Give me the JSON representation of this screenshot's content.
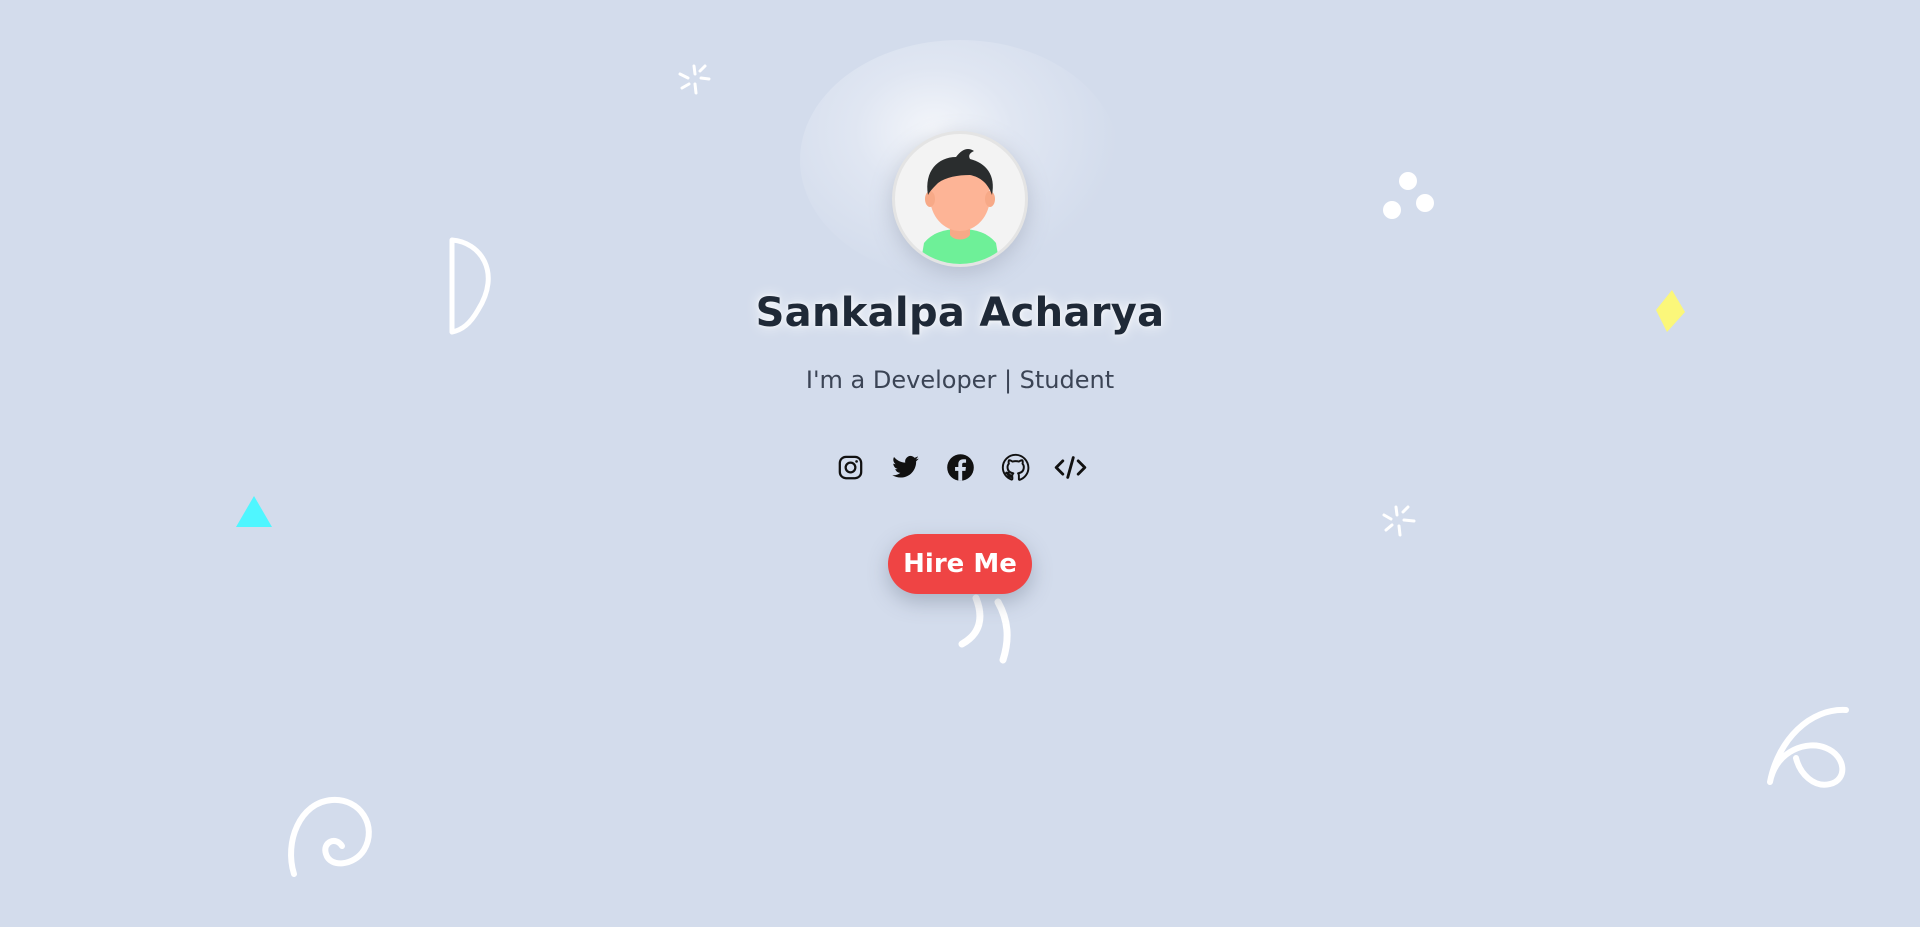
{
  "profile": {
    "name": "Sankalpa Acharya",
    "tagline": "I'm a Developer | Student",
    "avatar_icon": "avatar-illustration-icon"
  },
  "socials": [
    {
      "name": "instagram",
      "icon": "instagram-icon"
    },
    {
      "name": "twitter",
      "icon": "twitter-icon"
    },
    {
      "name": "facebook",
      "icon": "facebook-icon"
    },
    {
      "name": "github",
      "icon": "github-icon"
    },
    {
      "name": "code",
      "icon": "code-icon"
    }
  ],
  "cta": {
    "label": "Hire Me"
  },
  "colors": {
    "background": "#d3dcec",
    "button": "#ef4444",
    "name_text": "#1f2937",
    "accent_cyan": "#4ff6ff",
    "accent_yellow": "#fbf77a"
  }
}
